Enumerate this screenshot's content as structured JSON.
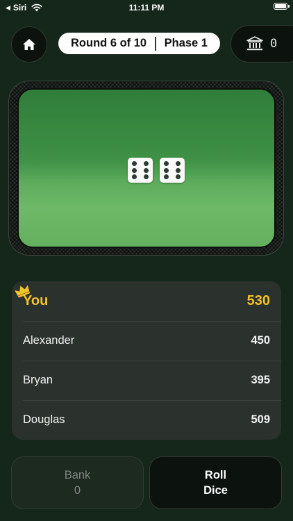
{
  "status_bar": {
    "back_glyph": "◀",
    "back_app": "Siri",
    "time": "11:11 PM",
    "wifi_icon": "wifi-icon",
    "battery_icon": "battery-icon",
    "battery_level": 1.0
  },
  "header": {
    "home_icon": "home-icon",
    "round_label": "Round 6 of 10",
    "phase_label": "Phase 1",
    "bank_icon": "bank-icon",
    "bank_value": "0"
  },
  "table": {
    "dice": [
      6,
      6
    ]
  },
  "scoreboard": {
    "crown_icon": "crown-icon",
    "rows": [
      {
        "name": "You",
        "score": "530",
        "is_leader": true
      },
      {
        "name": "Alexander",
        "score": "450"
      },
      {
        "name": "Bryan",
        "score": "395"
      },
      {
        "name": "Douglas",
        "score": "509"
      }
    ]
  },
  "actions": {
    "bank_label": "Bank",
    "bank_amount": "0",
    "roll_label_line1": "Roll",
    "roll_label_line2": "Dice"
  },
  "colors": {
    "background": "#15271b",
    "felt": "#4fa052",
    "leader_gold": "#f3c327",
    "pip": "#2e3d33"
  }
}
